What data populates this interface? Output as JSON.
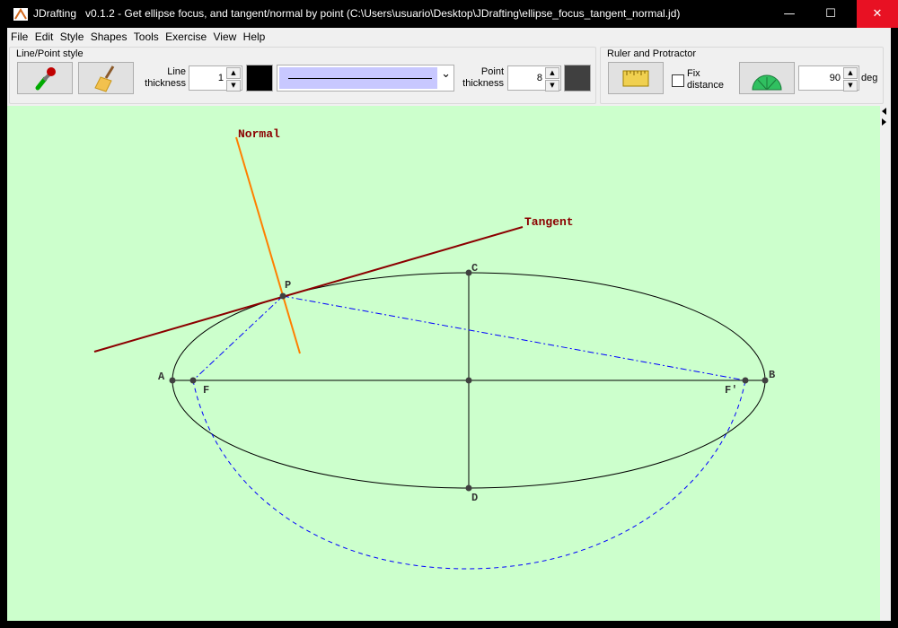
{
  "window": {
    "app_name": "JDrafting",
    "title_rest": "v0.1.2 - Get ellipse focus, and tangent/normal by point (C:\\Users\\usuario\\Desktop\\JDrafting\\ellipse_focus_tangent_normal.jd)",
    "minimize": "—",
    "maximize": "☐",
    "close": "✕"
  },
  "menu": [
    "File",
    "Edit",
    "Style",
    "Shapes",
    "Tools",
    "Exercise",
    "View",
    "Help"
  ],
  "line_point_style": {
    "group_label": "Line/Point style",
    "line_thickness_label_1": "Line",
    "line_thickness_label_2": "thickness",
    "line_thickness": "1",
    "line_color": "#000000",
    "point_thickness_label_1": "Point",
    "point_thickness_label_2": "thickness",
    "point_thickness": "8",
    "point_color": "#404040",
    "combo_arrow": "⌄"
  },
  "ruler_protractor": {
    "group_label": "Ruler and Protractor",
    "fix_label_1": "Fix",
    "fix_label_2": "distance",
    "fix_distance_checked": false,
    "angle": "90",
    "angle_unit": "deg"
  },
  "drawing": {
    "background": "#ccffcc",
    "labels": {
      "normal": "Normal",
      "tangent": "Tangent",
      "A": "A",
      "B": "B",
      "C": "C",
      "D": "D",
      "P": "P",
      "F": "F",
      "F2": "F'"
    },
    "colors": {
      "normal": "#ff7f00",
      "tangent": "#8b0000",
      "construction": "#0000ff",
      "ellipse": "#000000",
      "points": "#404040"
    }
  }
}
